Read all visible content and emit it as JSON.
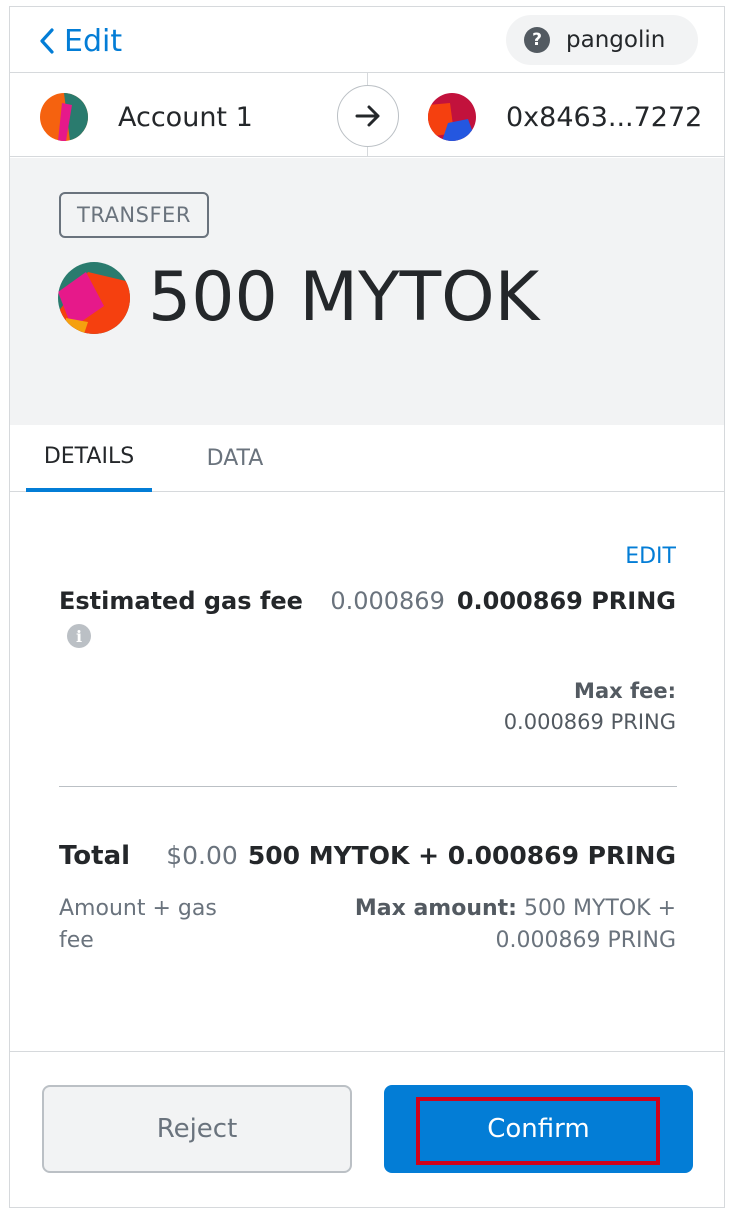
{
  "header": {
    "back_label": "Edit",
    "network": "pangolin",
    "help_glyph": "?"
  },
  "accounts": {
    "from_name": "Account 1",
    "to_address": "0x8463...7272"
  },
  "summary": {
    "action": "TRANSFER",
    "amount": "500 MYTOK"
  },
  "tabs": [
    {
      "label": "DETAILS",
      "active": true
    },
    {
      "label": "DATA",
      "active": false
    }
  ],
  "gas": {
    "edit_label": "EDIT",
    "label": "Estimated gas fee",
    "secondary": "0.000869",
    "primary": "0.000869 PRING",
    "max_fee_label": "Max fee:",
    "max_fee_value": "0.000869 PRING",
    "info_glyph": "i"
  },
  "total": {
    "label": "Total",
    "secondary": "$0.00",
    "primary": "500 MYTOK + 0.000869 PRING",
    "sub_label": "Amount + gas fee",
    "max_amount_label": "Max amount:",
    "max_amount_value": "500 MYTOK + 0.000869 PRING"
  },
  "buttons": {
    "reject": "Reject",
    "confirm": "Confirm"
  },
  "colors": {
    "accent": "#037dd6",
    "highlight": "#d0021b",
    "summary_bg": "#f2f3f4"
  }
}
